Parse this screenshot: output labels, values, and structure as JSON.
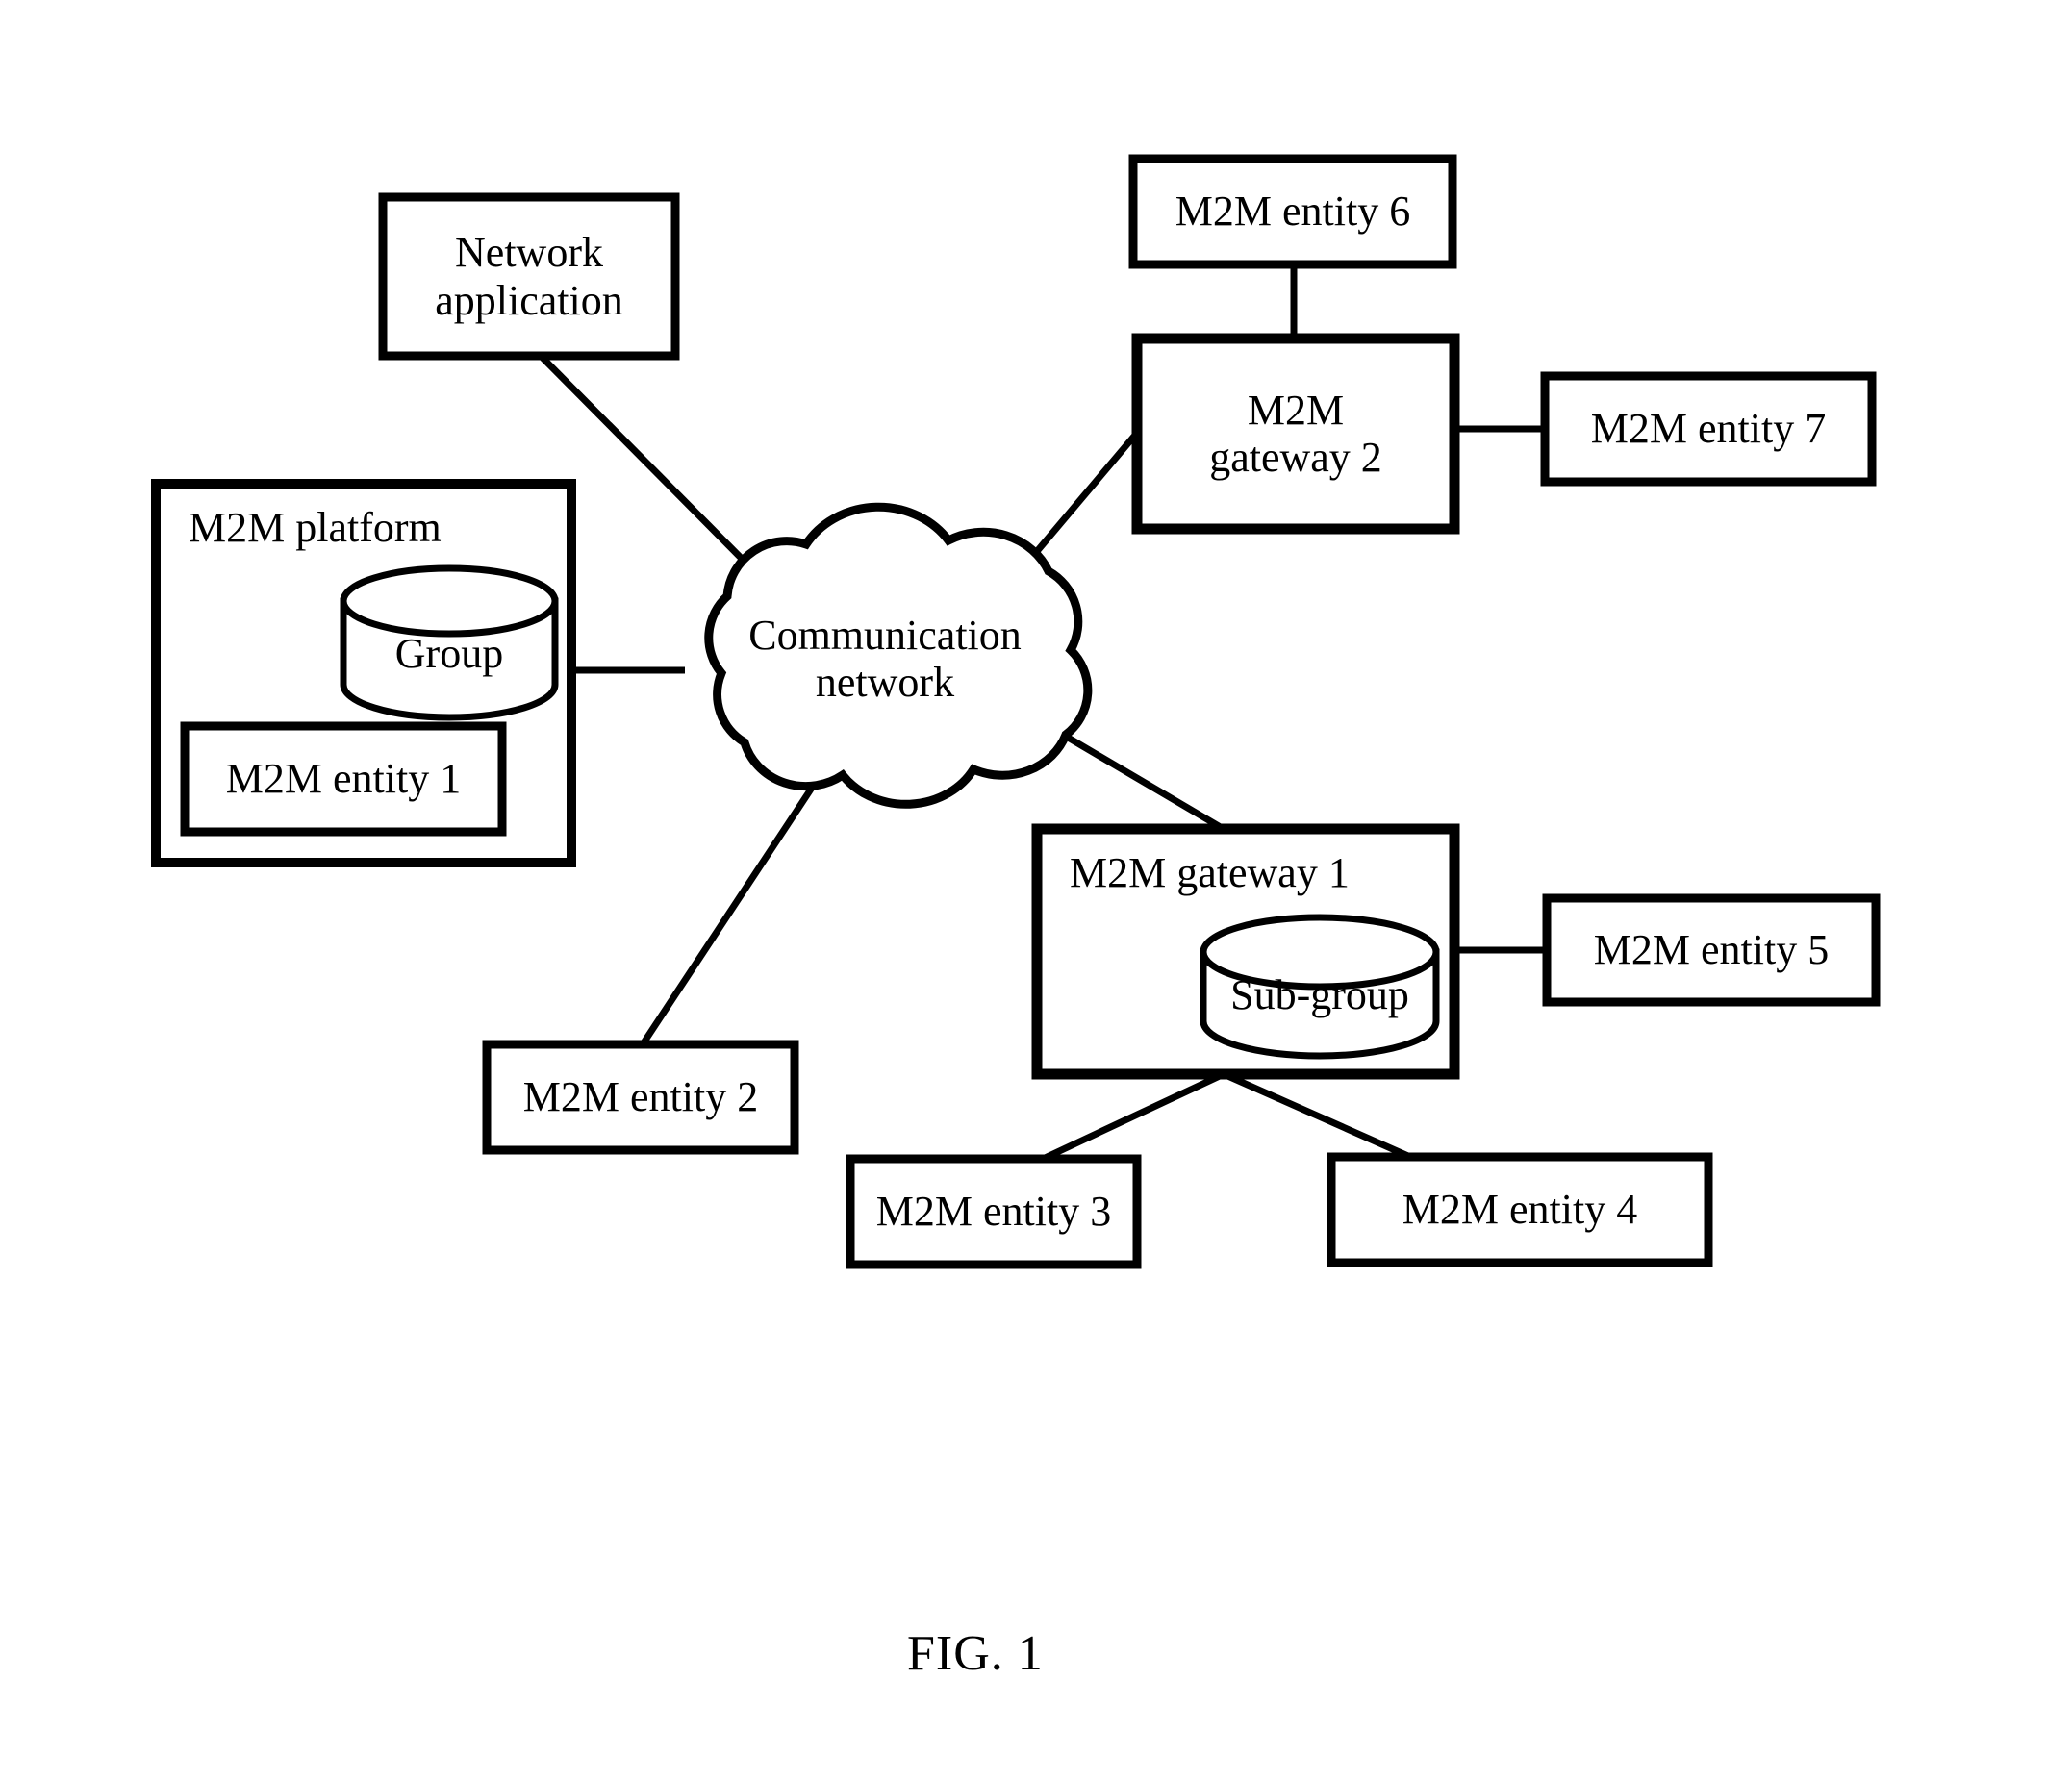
{
  "figure": {
    "caption": "FIG. 1",
    "background_color": "#ffffff",
    "stroke_color": "#000000"
  },
  "nodes": {
    "network_application": {
      "label": "Network\napplication",
      "shape": "rectangle"
    },
    "m2m_platform": {
      "label": "M2M platform",
      "shape": "rectangle"
    },
    "group": {
      "label": "Group",
      "shape": "cylinder"
    },
    "m2m_entity_1": {
      "label": "M2M entity 1",
      "shape": "rectangle"
    },
    "communication_network": {
      "label": "Communication\nnetwork",
      "shape": "cloud"
    },
    "m2m_entity_2": {
      "label": "M2M entity 2",
      "shape": "rectangle"
    },
    "m2m_entity_6": {
      "label": "M2M entity 6",
      "shape": "rectangle"
    },
    "m2m_gateway_2": {
      "label": "M2M\ngateway 2",
      "shape": "rectangle"
    },
    "m2m_entity_7": {
      "label": "M2M entity 7",
      "shape": "rectangle"
    },
    "m2m_gateway_1": {
      "label": "M2M gateway 1",
      "shape": "rectangle"
    },
    "sub_group": {
      "label": "Sub-group",
      "shape": "cylinder"
    },
    "m2m_entity_5": {
      "label": "M2M entity 5",
      "shape": "rectangle"
    },
    "m2m_entity_3": {
      "label": "M2M entity 3",
      "shape": "rectangle"
    },
    "m2m_entity_4": {
      "label": "M2M entity 4",
      "shape": "rectangle"
    }
  },
  "edges": [
    {
      "from": "network_application",
      "to": "communication_network"
    },
    {
      "from": "m2m_platform",
      "to": "communication_network"
    },
    {
      "from": "communication_network",
      "to": "m2m_entity_2"
    },
    {
      "from": "communication_network",
      "to": "m2m_gateway_2"
    },
    {
      "from": "communication_network",
      "to": "m2m_gateway_1"
    },
    {
      "from": "m2m_entity_6",
      "to": "m2m_gateway_2"
    },
    {
      "from": "m2m_gateway_2",
      "to": "m2m_entity_7"
    },
    {
      "from": "m2m_gateway_1",
      "to": "m2m_entity_5"
    },
    {
      "from": "m2m_gateway_1",
      "to": "m2m_entity_3"
    },
    {
      "from": "m2m_gateway_1",
      "to": "m2m_entity_4"
    }
  ]
}
